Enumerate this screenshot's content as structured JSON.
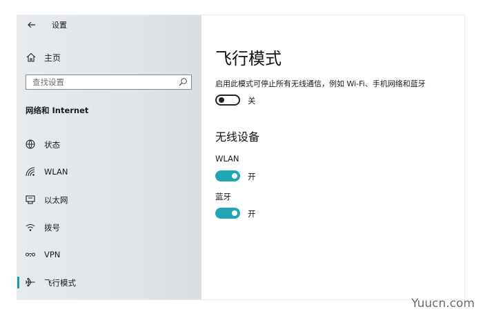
{
  "app": {
    "title": "设置"
  },
  "sidebar": {
    "home_label": "主页",
    "search_placeholder": "查找设置",
    "section_heading": "网络和 Internet",
    "items": [
      {
        "label": "状态",
        "icon": "globe-icon"
      },
      {
        "label": "WLAN",
        "icon": "wifi-icon"
      },
      {
        "label": "以太网",
        "icon": "ethernet-icon"
      },
      {
        "label": "拨号",
        "icon": "dialup-icon"
      },
      {
        "label": "VPN",
        "icon": "vpn-icon"
      },
      {
        "label": "飞行模式",
        "icon": "airplane-icon",
        "active": true
      }
    ]
  },
  "main": {
    "title": "飞行模式",
    "description": "启用此模式可停止所有无线通信，例如 Wi-Fi、手机网络和蓝牙",
    "airplane_toggle": {
      "state": "关",
      "on": false
    },
    "wireless_title": "无线设备",
    "wlan": {
      "label": "WLAN",
      "state": "开",
      "on": true
    },
    "bluetooth": {
      "label": "蓝牙",
      "state": "开",
      "on": true
    }
  },
  "colors": {
    "accent": "#1fa6b3",
    "sidebar_bg": "#e2e6ea"
  },
  "watermark": "Yuucn.com"
}
